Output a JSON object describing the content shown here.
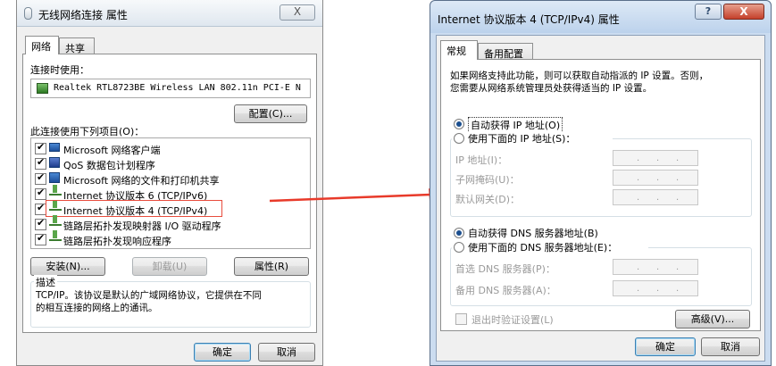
{
  "left": {
    "title": "无线网络连接 属性",
    "close_glyph": "X",
    "tabs": [
      "网络",
      "共享"
    ],
    "connect_using_label": "连接时使用：",
    "adapter_name": "Realtek RTL8723BE Wireless LAN 802.11n PCI-E N",
    "configure_label": "配置(C)...",
    "items_label": "此连接使用下列项目(O)：",
    "components": [
      {
        "label": "Microsoft 网络客户端",
        "icon": "network-client-icon",
        "checked": true
      },
      {
        "label": "QoS 数据包计划程序",
        "icon": "qos-scheduler-icon",
        "checked": true
      },
      {
        "label": "Microsoft 网络的文件和打印机共享",
        "icon": "file-printer-sharing-icon",
        "checked": true
      },
      {
        "label": "Internet 协议版本 6 (TCP/IPv6)",
        "icon": "protocol-icon",
        "checked": true
      },
      {
        "label": "Internet 协议版本 4 (TCP/IPv4)",
        "icon": "protocol-icon",
        "checked": true
      },
      {
        "label": "链路层拓扑发现映射器 I/O 驱动程序",
        "icon": "protocol-icon",
        "checked": true
      },
      {
        "label": "链路层拓扑发现响应程序",
        "icon": "protocol-icon",
        "checked": true
      }
    ],
    "install_label": "安装(N)...",
    "uninstall_label": "卸载(U)",
    "properties_label": "属性(R)",
    "description_title": "描述",
    "description_line1": "TCP/IP。该协议是默认的广域网络协议，它提供在不同",
    "description_line2": "的相互连接的网络上的通讯。",
    "ok_label": "确定",
    "cancel_label": "取消"
  },
  "right": {
    "title": "Internet 协议版本 4 (TCP/IPv4) 属性",
    "help_glyph": "?",
    "close_glyph": "X",
    "tabs": [
      "常规",
      "备用配置"
    ],
    "intro_line1": "如果网络支持此功能，则可以获取自动指派的 IP 设置。否则，",
    "intro_line2": "您需要从网络系统管理员处获得适当的 IP 设置。",
    "auto_ip_label": "自动获得 IP 地址(O)",
    "manual_ip_label": "使用下面的 IP 地址(S)：",
    "ip_address_label": "IP 地址(I)：",
    "subnet_label": "子网掩码(U)：",
    "gateway_label": "默认网关(D)：",
    "auto_dns_label": "自动获得 DNS 服务器地址(B)",
    "manual_dns_label": "使用下面的 DNS 服务器地址(E)：",
    "preferred_dns_label": "首选 DNS 服务器(P)：",
    "alternate_dns_label": "备用 DNS 服务器(A)：",
    "validate_label": "退出时验证设置(L)",
    "advanced_label": "高级(V)...",
    "ok_label": "确定",
    "cancel_label": "取消",
    "ip_dot": "."
  },
  "colors": {
    "highlight_border": "#e84c3d",
    "arrow": "#e83a2a",
    "window_frame": "#cbdcf0",
    "default_button_border": "#3c7fb1"
  }
}
